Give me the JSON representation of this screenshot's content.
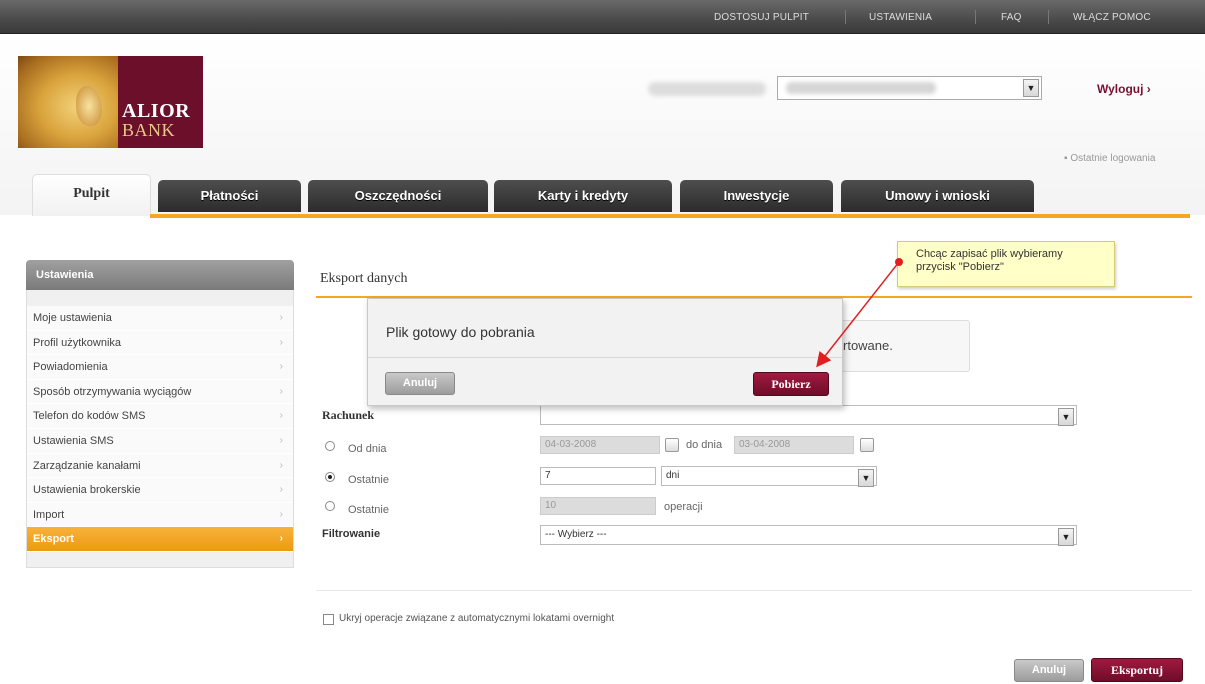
{
  "topnav": {
    "items": [
      "DOSTOSUJ PULPIT",
      "USTAWIENIA",
      "FAQ",
      "WŁĄCZ POMOC"
    ]
  },
  "logo": {
    "line1": "ALIOR",
    "line2": "BANK"
  },
  "header": {
    "logout": "Wyloguj ›",
    "last_login": "▪ Ostatnie logowania"
  },
  "tabs": [
    "Pulpit",
    "Płatności",
    "Oszczędności",
    "Karty i kredyty",
    "Inwestycje",
    "Umowy i wnioski"
  ],
  "sidebar": {
    "title": "Ustawienia",
    "items": [
      {
        "label": "Moje ustawienia"
      },
      {
        "label": "Profil użytkownika"
      },
      {
        "label": "Powiadomienia"
      },
      {
        "label": "Sposób otrzymywania wyciągów"
      },
      {
        "label": "Telefon do kodów SMS"
      },
      {
        "label": "Ustawienia SMS"
      },
      {
        "label": "Zarządzanie kanałami"
      },
      {
        "label": "Ustawienia brokerskie"
      },
      {
        "label": "Import"
      },
      {
        "label": "Eksport"
      }
    ],
    "arrow": "›"
  },
  "main": {
    "title": "Eksport danych",
    "info_text": "rtowane.",
    "rachunek_label": "Rachunek",
    "od_dnia_label": "Od dnia",
    "od_dnia_value": "04-03-2008",
    "do_dnia_label": "do dnia",
    "do_dnia_value": "03-04-2008",
    "ostatnie_label": "Ostatnie",
    "ostatnie_value": "7",
    "period_unit": "dni",
    "ostatnie2_label": "Ostatnie",
    "ostatnie2_value": "10",
    "operations_label": "operacji",
    "filter_label": "Filtrowanie",
    "filter_value": "--- Wybierz ---",
    "overnight_label": "Ukryj operacje związane z automatycznymi lokatami overnight",
    "cancel_label": "Anuluj",
    "export_label": "Eksportuj"
  },
  "modal": {
    "title": "Plik gotowy do pobrania",
    "cancel_label": "Anuluj",
    "download_label": "Pobierz"
  },
  "tooltip": {
    "line1": "Chcąc zapisać plik wybieramy",
    "line2": "przycisk \"Pobierz\""
  },
  "colors": {
    "accent": "#f5a623",
    "brand": "#7a1030",
    "arrow": "#e02020"
  }
}
